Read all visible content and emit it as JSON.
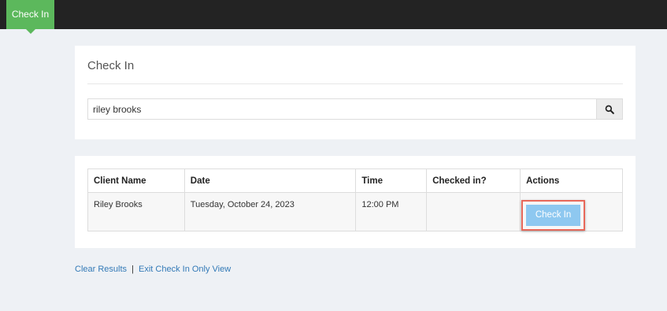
{
  "topbar": {
    "tab_label": "Check In",
    "accent_color": "#5cb85c"
  },
  "search_panel": {
    "title": "Check In",
    "search_value": "riley brooks",
    "search_icon": "search-icon"
  },
  "results": {
    "columns": [
      "Client Name",
      "Date",
      "Time",
      "Checked in?",
      "Actions"
    ],
    "rows": [
      {
        "client_name": "Riley Brooks",
        "date": "Tuesday, October 24, 2023",
        "time": "12:00 PM",
        "checked_in": "",
        "action_label": "Check In"
      }
    ]
  },
  "footer": {
    "clear_results": "Clear Results",
    "separator": "|",
    "exit_view": "Exit Check In Only View"
  }
}
